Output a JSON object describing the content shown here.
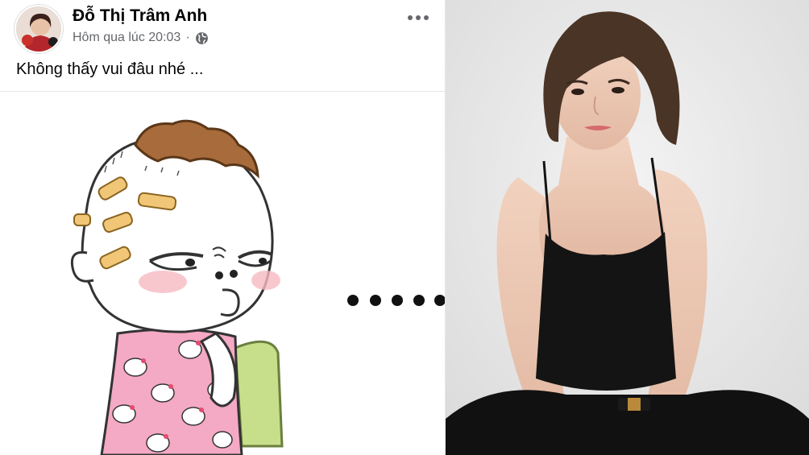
{
  "post": {
    "author": "Đỗ Thị Trâm Anh",
    "timestamp": "Hôm qua lúc 20:03",
    "separator": "·",
    "privacy_icon": "globe-icon",
    "more_icon": "more-options-icon",
    "caption": "Không thấy vui đâu nhé ...",
    "image_description_icon": "sticker-image"
  },
  "colors": {
    "author_text": "#050505",
    "meta_text": "#65676b",
    "divider": "#e4e6eb"
  }
}
